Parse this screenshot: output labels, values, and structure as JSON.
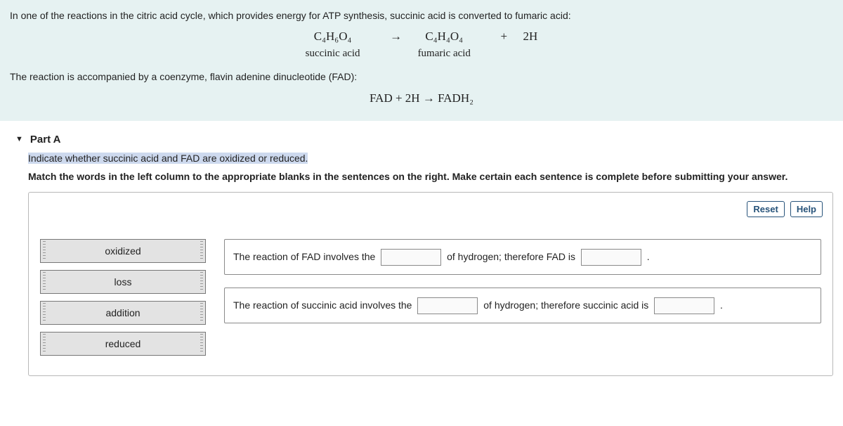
{
  "intro": {
    "line1": "In one of the reactions in the citric acid cycle, which provides energy for ATP synthesis, succinic acid is converted to fumaric acid:",
    "eq1_left_formula": "C₄H₆O₄",
    "eq1_left_label": "succinic acid",
    "eq1_arrow": "→",
    "eq1_right_formula": "C₄H₄O₄",
    "eq1_right_label": "fumaric acid",
    "eq1_plus": "+",
    "eq1_h": "2H",
    "line2": "The reaction is accompanied by a coenzyme, flavin adenine dinucleotide (FAD):",
    "eq2": "FAD + 2H → FADH₂"
  },
  "part": {
    "label": "Part A",
    "prompt_highlight": "Indicate whether succinic acid and FAD are oxidized or reduced.",
    "instructions": "Match the words in the left column to the appropriate blanks in the sentences on the right. Make certain each sentence is complete before submitting your answer."
  },
  "tools": {
    "reset": "Reset",
    "help": "Help"
  },
  "bank": {
    "items": [
      "oxidized",
      "loss",
      "addition",
      "reduced"
    ]
  },
  "sentences": {
    "s1_a": "The reaction of FAD involves the",
    "s1_b": "of hydrogen; therefore FAD is",
    "s1_end": ".",
    "s2_a": "The reaction of succinic acid involves the",
    "s2_b": "of hydrogen; therefore succinic acid is",
    "s2_end": "."
  }
}
